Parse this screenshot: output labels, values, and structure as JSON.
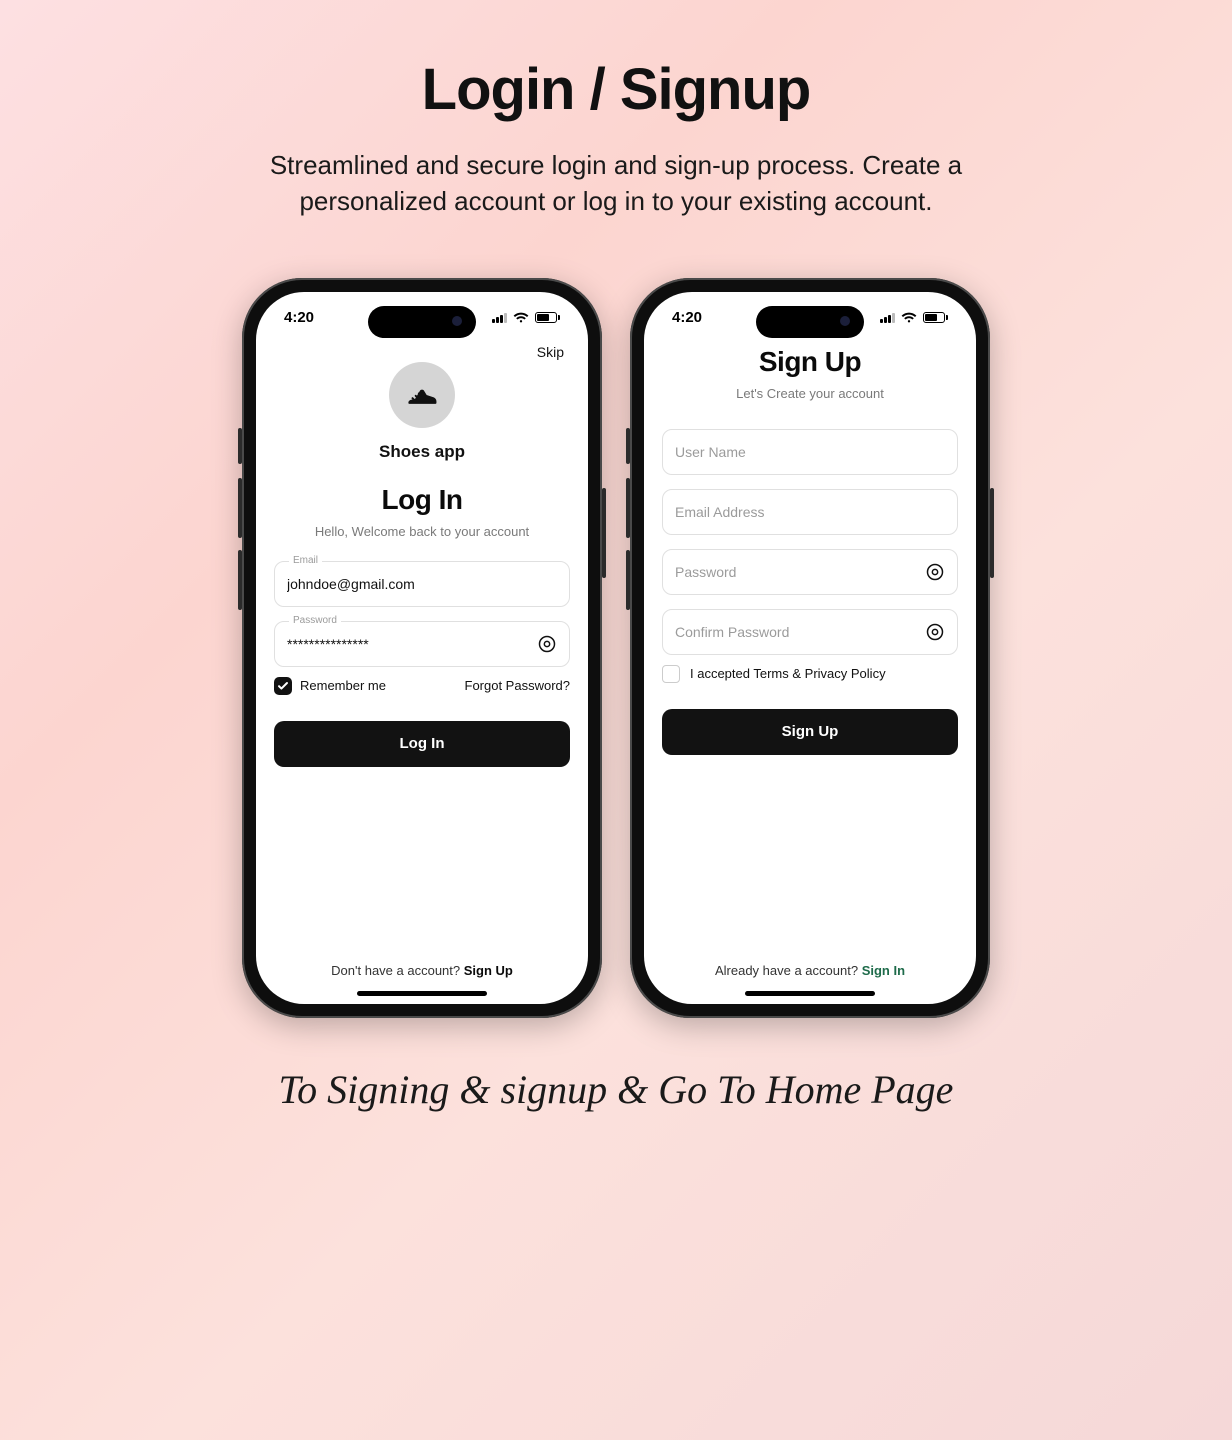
{
  "page": {
    "title": "Login / Signup",
    "subtitle": "Streamlined and secure login and sign-up process. Create a personalized account or log in to your existing account.",
    "footer": "To Signing & signup & Go To Home Page"
  },
  "status": {
    "time": "4:20"
  },
  "login": {
    "skip": "Skip",
    "app_name": "Shoes app",
    "heading": "Log In",
    "subtext": "Hello, Welcome back to your account",
    "email_label": "Email",
    "email_value": "johndoe@gmail.com",
    "password_label": "Password",
    "password_value": "***************",
    "remember_label": "Remember me",
    "forgot_label": "Forgot Password?",
    "submit": "Log In",
    "bottom_prefix": "Don't have a account? ",
    "bottom_action": "Sign Up"
  },
  "signup": {
    "heading": "Sign Up",
    "subtext": "Let's Create your account",
    "username_placeholder": "User Name",
    "email_placeholder": "Email Address",
    "password_placeholder": "Password",
    "confirm_placeholder": "Confirm Password",
    "accept_prefix": "I accepted ",
    "accept_terms": "Terms & Privacy Policy",
    "submit": "Sign Up",
    "bottom_prefix": "Already have a account? ",
    "bottom_action": "Sign In"
  }
}
